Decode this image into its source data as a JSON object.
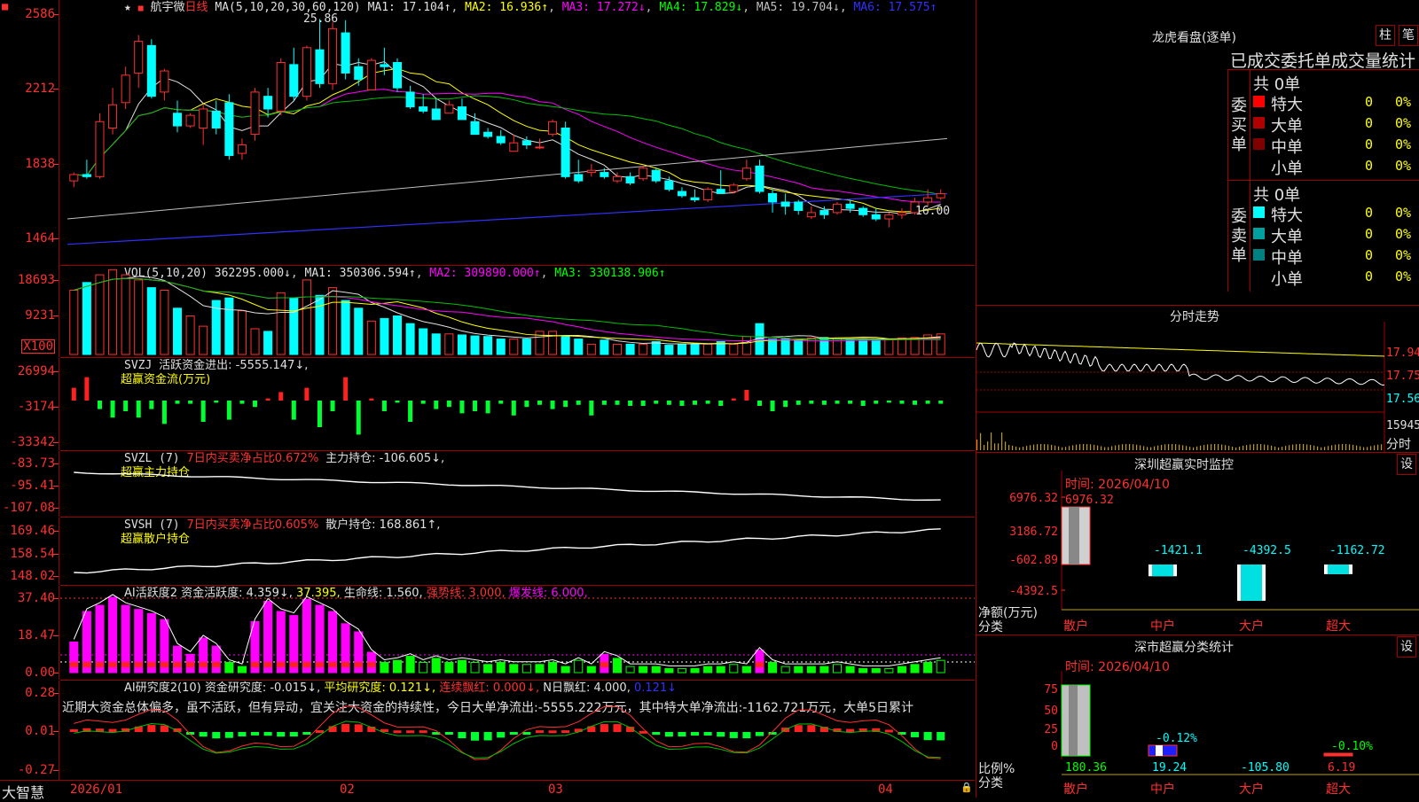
{
  "stock": {
    "name": "航宇微",
    "period": "日线"
  },
  "logo": "大智慧",
  "ma_header": {
    "label": "MA(5,10,20,30,60,120)",
    "ma1": "MA1: 17.104↑",
    "ma2": "MA2: 16.936↑",
    "ma3": "MA3: 17.272↓",
    "ma4": "MA4: 17.829↓",
    "ma5": "MA5: 19.704↓",
    "ma6": "MA6: 17.575↑"
  },
  "price_axis": [
    "2586",
    "2212",
    "1838",
    "1464"
  ],
  "price_annotations": {
    "high": "25.86",
    "low": "16.00"
  },
  "vol_header": {
    "label": "VOL(5,10,20)",
    "value": "362295.000↓",
    "ma1": "MA1: 350306.594↑",
    "ma2": "MA2: 309890.000↑",
    "ma3": "MA3: 330138.906↑"
  },
  "vol_axis": [
    "18693",
    "9231",
    "X100"
  ],
  "svzj": {
    "label": "SVZJ",
    "t1": "活跃资金进出: -5555.147↓,",
    "t2": "超赢资金流(万元)",
    "axis": [
      "26994",
      "-3174",
      "-33342"
    ]
  },
  "svzl": {
    "label": "SVZL (7)",
    "t1": "7日内买卖净占比0.672%",
    "t2": "主力持仓: -106.605↓,",
    "t3": "超赢主力持仓",
    "axis": [
      "-83.73",
      "-95.41",
      "-107.08"
    ]
  },
  "svsh": {
    "label": "SVSH (7)",
    "t1": "7日内买卖净占比0.605%",
    "t2": "散户持仓: 168.861↑,",
    "t3": "超赢散户持仓",
    "axis": [
      "169.46",
      "158.54",
      "148.02"
    ]
  },
  "ai1": {
    "label": "AI活跃度2",
    "t1": "资金活跃度: 4.359↓,",
    "t2": "37.395,",
    "t3": "生命线: 1.560,",
    "t4": "强势线: 3.000,",
    "t5": "爆发线: 6.000,",
    "axis": [
      "37.40",
      "18.47",
      "0.00"
    ]
  },
  "ai2": {
    "label": "AI研究度2(10)",
    "t1": "资金研究度: -0.015↓,",
    "t2": "平均研究度: 0.121↓,",
    "t3": "连续飘红: 0.000↓,",
    "t4": "N日飘红: 4.000,",
    "t5": "0.121↓",
    "axis": [
      "0.28",
      "0.01",
      "-0.27"
    ],
    "comment": "近期大资金总体偏多，虽不活跃，但有异动，宜关注大资金的持续性，今日大单净流出:-5555.222万元，其中特大单净流出:-1162.721万元，大单5日累计"
  },
  "date_axis": [
    "2026/01",
    "02",
    "03",
    "04"
  ],
  "dragon": {
    "title": "龙虎看盘(逐单)",
    "btn1": "柱",
    "btn2": "笔",
    "header": "已成交委托单成交量统计",
    "buy_side": "委买单",
    "sell_side": "委卖单",
    "buy_total": "共 0单",
    "sell_total": "共 0单",
    "buy_rows": [
      {
        "label": "特大",
        "vol": "0",
        "pct": "0%",
        "color": "#ff0000"
      },
      {
        "label": "大单",
        "vol": "0",
        "pct": "0%",
        "color": "#b00000"
      },
      {
        "label": "中单",
        "vol": "0",
        "pct": "0%",
        "color": "#800000"
      },
      {
        "label": "小单",
        "vol": "0",
        "pct": "0%",
        "color": "#000000"
      }
    ],
    "sell_rows": [
      {
        "label": "特大",
        "vol": "0",
        "pct": "0%",
        "color": "#00ffff"
      },
      {
        "label": "大单",
        "vol": "0",
        "pct": "0%",
        "color": "#00a0a0"
      },
      {
        "label": "中单",
        "vol": "0",
        "pct": "0%",
        "color": "#008080"
      },
      {
        "label": "小单",
        "vol": "0",
        "pct": "0%",
        "color": "#000000"
      }
    ]
  },
  "intraday": {
    "title": "分时走势",
    "axis": [
      "17.94",
      "17.75",
      "17.56",
      "15945"
    ],
    "unit": "分时"
  },
  "monitor": {
    "title": "深圳超赢实时监控",
    "btn": "设",
    "date": "时间: 2026/04/10",
    "axis": [
      "6976.32",
      "3186.72",
      "-602.89",
      "-4392.5"
    ],
    "ylabel": "净额(万元)",
    "xlabel": "分类",
    "categories": [
      "散户",
      "中户",
      "大户",
      "超大"
    ],
    "values": [
      6976.32,
      -1421.1,
      -4392.5,
      -1162.72
    ],
    "value_labels": [
      "6976.32",
      "-1421.1",
      "-4392.5",
      "-1162.72"
    ]
  },
  "classify": {
    "title": "深市超赢分类统计",
    "btn": "设",
    "date": "时间: 2026/04/10",
    "axis": [
      "75",
      "50",
      "25",
      "0"
    ],
    "ylabel": "比例%",
    "xlabel": "分类",
    "categories": [
      "散户",
      "中户",
      "大户",
      "超大"
    ],
    "top_labels": [
      "",
      "-0.12%",
      "",
      "-0.10%"
    ],
    "bottom_labels": [
      "180.36",
      "19.24",
      "-105.80",
      "6.19"
    ],
    "heights": [
      80,
      12,
      0,
      3
    ],
    "bottom_colors": [
      "#00ff00",
      "#00ffff",
      "#00ffff",
      "#ff3030"
    ]
  },
  "chart_data": {
    "type": "candlestick",
    "candles": [
      [
        18.2,
        18.6,
        17.9,
        18.5
      ],
      [
        18.5,
        19.2,
        18.3,
        18.4
      ],
      [
        18.4,
        21.4,
        18.3,
        21.0
      ],
      [
        20.7,
        22.6,
        20.4,
        21.8
      ],
      [
        21.9,
        23.6,
        21.6,
        23.2
      ],
      [
        23.3,
        25.1,
        22.6,
        24.8
      ],
      [
        24.6,
        24.9,
        22.1,
        22.2
      ],
      [
        22.4,
        23.5,
        22.0,
        23.4
      ],
      [
        21.4,
        22.0,
        20.5,
        20.8
      ],
      [
        20.8,
        21.4,
        20.7,
        21.3
      ],
      [
        20.7,
        21.8,
        19.9,
        21.6
      ],
      [
        21.5,
        22.0,
        20.4,
        20.7
      ],
      [
        21.9,
        22.3,
        19.2,
        19.4
      ],
      [
        19.5,
        20.2,
        19.2,
        19.9
      ],
      [
        20.4,
        22.6,
        20.1,
        22.4
      ],
      [
        22.2,
        22.6,
        21.2,
        21.6
      ],
      [
        21.5,
        24.0,
        21.3,
        23.8
      ],
      [
        23.7,
        24.5,
        22.0,
        22.2
      ],
      [
        22.2,
        24.6,
        22.0,
        24.5
      ],
      [
        24.4,
        25.86,
        22.6,
        22.8
      ],
      [
        22.8,
        25.7,
        22.5,
        25.4
      ],
      [
        25.2,
        25.8,
        23.0,
        23.3
      ],
      [
        23.6,
        24.0,
        22.7,
        23.0
      ],
      [
        22.5,
        24.0,
        22.5,
        23.9
      ],
      [
        23.7,
        24.5,
        23.2,
        23.6
      ],
      [
        23.8,
        24.0,
        22.4,
        22.6
      ],
      [
        22.4,
        22.7,
        21.6,
        21.7
      ],
      [
        21.7,
        22.3,
        21.4,
        21.5
      ],
      [
        21.6,
        22.1,
        21.2,
        21.1
      ],
      [
        21.4,
        22.0,
        21.6,
        21.8
      ],
      [
        21.7,
        22.1,
        21.2,
        21.1
      ],
      [
        21.0,
        21.4,
        20.5,
        20.4
      ],
      [
        20.5,
        20.7,
        20.2,
        20.3
      ],
      [
        20.3,
        20.6,
        19.9,
        20.0
      ],
      [
        19.6,
        20.4,
        19.6,
        20.0
      ],
      [
        20.1,
        20.3,
        19.7,
        19.9
      ],
      [
        19.8,
        20.2,
        19.7,
        19.8
      ],
      [
        20.4,
        21.1,
        20.3,
        21.0
      ],
      [
        20.7,
        21.0,
        18.3,
        18.4
      ],
      [
        18.5,
        19.2,
        18.1,
        18.2
      ],
      [
        18.6,
        19.0,
        18.4,
        18.7
      ],
      [
        18.6,
        18.8,
        18.3,
        18.4
      ],
      [
        18.2,
        18.6,
        18.1,
        18.4
      ],
      [
        18.4,
        18.6,
        18.0,
        18.1
      ],
      [
        18.3,
        18.9,
        18.2,
        18.8
      ],
      [
        18.7,
        18.8,
        18.1,
        18.2
      ],
      [
        18.2,
        18.4,
        17.7,
        17.8
      ],
      [
        17.7,
        17.9,
        17.4,
        17.5
      ],
      [
        17.4,
        17.8,
        17.2,
        17.3
      ],
      [
        17.3,
        17.9,
        17.2,
        17.8
      ],
      [
        17.8,
        18.7,
        17.6,
        17.6
      ],
      [
        17.7,
        18.1,
        17.6,
        18.0
      ],
      [
        18.3,
        19.2,
        18.2,
        18.8
      ],
      [
        18.9,
        19.2,
        17.6,
        17.7
      ],
      [
        17.6,
        17.8,
        16.7,
        17.2
      ],
      [
        17.2,
        17.6,
        16.6,
        17.0
      ],
      [
        17.2,
        17.3,
        16.6,
        16.8
      ],
      [
        16.5,
        17.0,
        16.4,
        16.7
      ],
      [
        16.8,
        17.0,
        16.4,
        16.6
      ],
      [
        16.7,
        17.2,
        16.6,
        17.1
      ],
      [
        17.1,
        17.3,
        16.7,
        16.9
      ],
      [
        16.9,
        17.0,
        16.5,
        16.6
      ],
      [
        16.6,
        16.9,
        16.3,
        16.4
      ],
      [
        16.4,
        16.7,
        16.0,
        16.6
      ],
      [
        16.6,
        16.9,
        16.4,
        16.7
      ],
      [
        16.7,
        17.4,
        16.6,
        17.2
      ],
      [
        17.2,
        17.8,
        17.0,
        17.4
      ],
      [
        17.4,
        17.8,
        17.3,
        17.6
      ]
    ],
    "volume": [
      1.25,
      1.4,
      1.55,
      1.65,
      1.55,
      1.45,
      1.3,
      1.25,
      0.9,
      0.75,
      0.55,
      1.05,
      1.1,
      0.85,
      0.5,
      0.45,
      1.2,
      1.1,
      1.45,
      1.15,
      1.3,
      1.05,
      0.9,
      0.65,
      0.7,
      0.75,
      0.6,
      0.5,
      0.4,
      0.4,
      0.38,
      0.36,
      0.35,
      0.3,
      0.3,
      0.3,
      0.45,
      0.45,
      0.35,
      0.3,
      0.2,
      0.28,
      0.2,
      0.2,
      0.2,
      0.25,
      0.18,
      0.2,
      0.2,
      0.2,
      0.25,
      0.2,
      0.35,
      0.6,
      0.3,
      0.3,
      0.28,
      0.32,
      0.33,
      0.3,
      0.3,
      0.3,
      0.3,
      0.3,
      0.32,
      0.33,
      0.38,
      0.4
    ],
    "fund_flow": [
      12,
      22,
      -8,
      -16,
      -10,
      -16,
      -8,
      -22,
      -3,
      -3,
      -20,
      -2,
      -18,
      -3,
      -6,
      2,
      8,
      -18,
      12,
      -25,
      -10,
      22,
      -32,
      2,
      -10,
      -2,
      -20,
      -3,
      -8,
      -6,
      -12,
      -10,
      -12,
      -3,
      -14,
      -6,
      -4,
      -8,
      -6,
      -4,
      -14,
      -4,
      -4,
      -5,
      -5,
      -3,
      -4,
      -5,
      -4,
      -3,
      -5,
      2,
      10,
      -5,
      -10,
      -6,
      -4,
      -3,
      -4,
      -3,
      -3,
      -5,
      -3,
      -2,
      -3,
      -4,
      -3,
      -3
    ],
    "ai_activity": [
      15,
      30,
      33,
      37,
      33,
      31,
      29,
      26,
      13,
      9,
      17,
      13,
      5,
      3,
      25,
      35,
      30,
      28,
      36,
      33,
      30,
      24,
      20,
      10,
      5,
      6,
      8,
      5,
      7,
      5,
      6,
      5,
      4,
      5,
      4,
      4,
      4,
      5,
      3,
      6,
      3,
      9,
      7,
      3,
      3,
      3,
      2,
      2,
      2,
      3,
      3,
      4,
      3,
      11,
      5,
      3,
      3,
      3,
      3,
      4,
      3,
      2,
      2,
      2,
      3,
      4,
      5,
      6
    ],
    "dates": [
      "2026/01",
      "02",
      "03",
      "04"
    ]
  }
}
